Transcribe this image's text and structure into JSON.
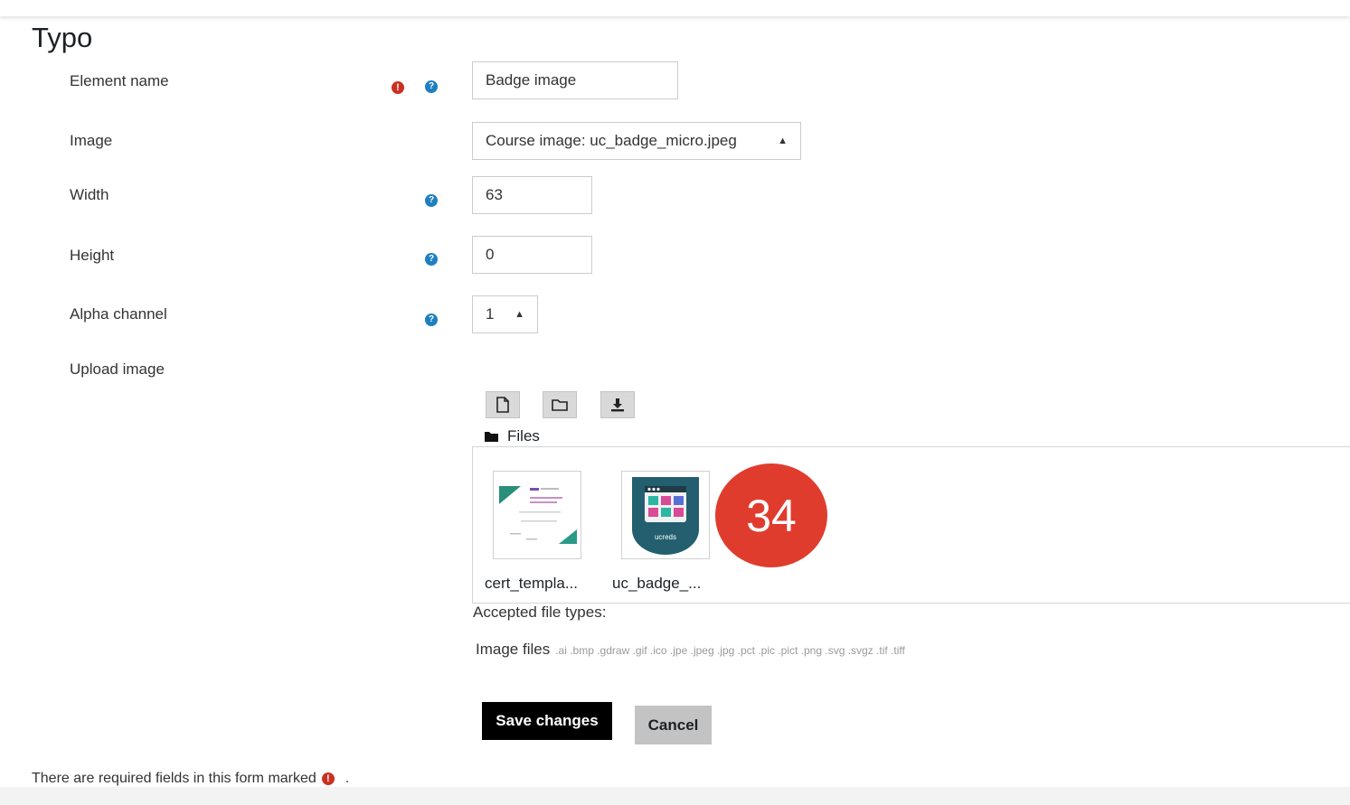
{
  "section_title": "Typo",
  "fields": {
    "element_name": {
      "label": "Element name",
      "value": "Badge image"
    },
    "image": {
      "label": "Image",
      "value": "Course image: uc_badge_micro.jpeg"
    },
    "width": {
      "label": "Width",
      "value": "63"
    },
    "height": {
      "label": "Height",
      "value": "0"
    },
    "alpha": {
      "label": "Alpha channel",
      "value": "1"
    },
    "upload": {
      "label": "Upload image"
    }
  },
  "filemanager": {
    "folder_label": "Files",
    "files": [
      {
        "name": "cert_templa..."
      },
      {
        "name": "uc_badge_...",
        "logo_text": "ucreds"
      }
    ],
    "accepted_label": "Accepted file types:",
    "types_label": "Image files",
    "types_list": ".ai .bmp .gdraw .gif .ico .jpe .jpeg .jpg .pct .pic .pict .png .svg .svgz .tif .tiff"
  },
  "buttons": {
    "save": "Save changes",
    "cancel": "Cancel"
  },
  "required_note": "There are required fields in this form marked",
  "required_note_end": ".",
  "annotation_badge": "34",
  "icons": {
    "required": "!",
    "help": "?"
  },
  "colors": {
    "required": "#ca3120",
    "help": "#1f7fc0",
    "badge": "#e03c2e",
    "save_bg": "#000000",
    "cancel_bg": "#c3c3c3"
  }
}
